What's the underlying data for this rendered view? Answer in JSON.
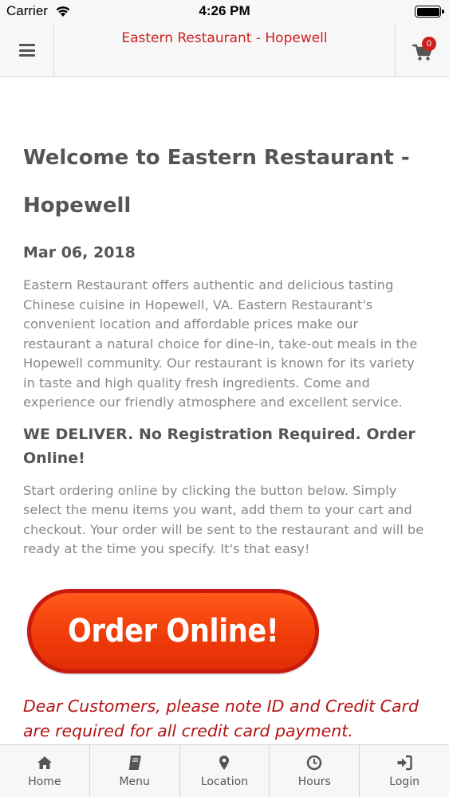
{
  "status_bar": {
    "carrier": "Carrier",
    "time": "4:26 PM"
  },
  "header": {
    "title": "Eastern Restaurant - Hopewell",
    "cart_count": "0",
    "menu_icon": "hamburger-icon",
    "cart_icon": "shopping-cart-icon"
  },
  "content": {
    "title": "Welcome to Eastern Restaurant - Hopewell",
    "date": "Mar 06, 2018",
    "intro": "Eastern Restaurant offers authentic and delicious tasting Chinese cuisine in Hopewell, VA.  Eastern Restaurant's convenient location and affordable prices make our restaurant a natural choice for dine-in, take-out meals in the Hopewell community. Our restaurant is known for its variety in taste and high quality fresh ingredients. Come and experience our friendly atmosphere and excellent service.",
    "subheading": "WE DELIVER. No Registration Required. Order Online!",
    "instructions": "Start ordering online by clicking the button below. Simply select the menu items you want, add them to your cart and checkout. Your order will be sent to the restaurant and will be ready at the time you specify. It's that easy!",
    "order_button": "Order Online!",
    "notice": "Dear Customers, please note ID and Credit Card are required for all credit card payment."
  },
  "tabs": [
    {
      "label": "Home",
      "icon": "home-icon"
    },
    {
      "label": "Menu",
      "icon": "book-icon"
    },
    {
      "label": "Location",
      "icon": "map-marker-icon"
    },
    {
      "label": "Hours",
      "icon": "clock-icon"
    },
    {
      "label": "Login",
      "icon": "sign-in-icon"
    }
  ],
  "colors": {
    "brand_red": "#cc1f1f",
    "order_button_orange": "#f03c0a",
    "notice_red": "#b41414"
  }
}
